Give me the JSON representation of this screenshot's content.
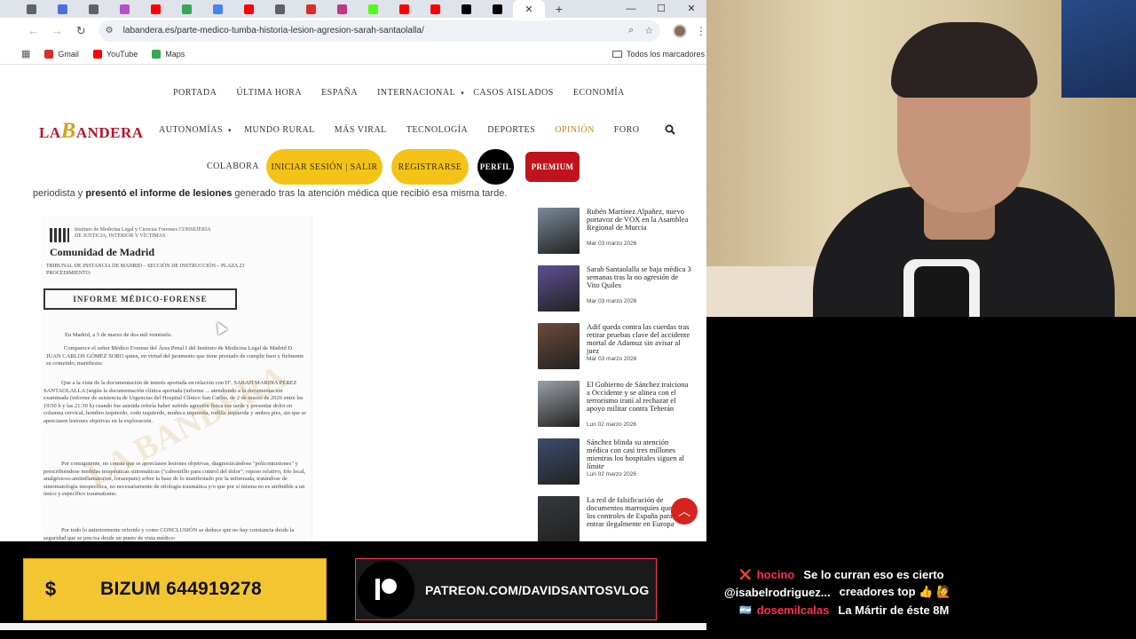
{
  "browser": {
    "url": "labandera.es/parte-medico-tumba-historia-lesion-agresion-sarah-santaolalla/",
    "new_tab_symbol": "+",
    "tabs": [
      {
        "icon": "chevron-down-icon",
        "color": "#5f6368"
      },
      {
        "icon": "b-icon",
        "color": "#4a6fe0"
      },
      {
        "icon": "shield-icon",
        "color": "#5f6368"
      },
      {
        "icon": "p-icon",
        "color": "#b64fc8"
      },
      {
        "icon": "youtube-icon",
        "color": "#ff0000"
      },
      {
        "icon": "puzzle-icon",
        "color": "#3aa655"
      },
      {
        "icon": "google-icon",
        "color": "#4285f4"
      },
      {
        "icon": "youtube-icon",
        "color": "#ff0000"
      },
      {
        "icon": "globe-icon",
        "color": "#5f6368"
      },
      {
        "icon": "gmail-icon",
        "color": "#d93025"
      },
      {
        "icon": "instagram-icon",
        "color": "#c13584"
      },
      {
        "icon": "kick-icon",
        "color": "#53fc18"
      },
      {
        "icon": "youtube-icon",
        "color": "#ff0000"
      },
      {
        "icon": "youtube-icon",
        "color": "#ff0000"
      },
      {
        "icon": "x-icon",
        "color": "#000000"
      },
      {
        "icon": "x-icon",
        "color": "#000000"
      }
    ],
    "bookmarks": [
      {
        "label": "Gmail",
        "color": "#d93025"
      },
      {
        "label": "YouTube",
        "color": "#ff0000"
      },
      {
        "label": "Maps",
        "color": "#34a853"
      }
    ],
    "all_bookmarks": "Todos los marcadores"
  },
  "site": {
    "logo_pre": "LA",
    "logo_big": "B",
    "logo_post": "ANDERA",
    "nav_row1": [
      "PORTADA",
      "ÚLTIMA HORA",
      "ESPAÑA",
      "INTERNACIONAL",
      "CASOS AISLADOS",
      "ECONOMÍA"
    ],
    "nav_row2": [
      "AUTONOMÍAS",
      "MUNDO RURAL",
      "MÁS VIRAL",
      "TECNOLOGÍA",
      "DEPORTES",
      "OPINIÓN",
      "FORO"
    ],
    "collabora": "COLABORA",
    "login": "INICIAR SESIÓN | SALIR",
    "register": "REGISTRARSE",
    "profile": "PERFIL",
    "premium": "PREMIUM",
    "colors": {
      "accent_red": "#b8142a",
      "pill_yellow": "#f3c417",
      "premium_red": "#c0141c",
      "opinion": "#b78a1a"
    }
  },
  "article": {
    "line_pre": "periodista y ",
    "line_bold": "presentó el informe de lesiones",
    "line_post": " generado tras la atención médica que recibió esa misma tarde."
  },
  "document": {
    "header": "Instituto de Medicina Legal y Ciencias Forenses CONSEJERÍA DE JUSTICIA, INTERIOR Y VÍCTIMAS",
    "community": "Comunidad de Madrid",
    "tribunal": "TRIBUNAL DE INSTANCIA DE MADRID – SECCIÓN DE INSTRUCCIÓN – PLAZA 23",
    "procedure": "PROCEDIMIENTO:",
    "box_title": "INFORME MÉDICO-FORENSE",
    "date_line": "En Madrid, a 5 de marzo de dos mil veintiséis.",
    "p1": "Comparece el señor Médico Forense del Área Penal I del Instituto de Medicina Legal de Madrid D. JUAN CARLOS GÓMEZ SORO quien, en virtud del juramento que tiene prestado de cumplir bien y fielmente su cometido, manifiesta:",
    "p2": "Que a la vista de la documentación de interés aportada en relación con Dª. SARAH MARINA PÉREZ SANTAOLALLA (según la documentación clínica aportada (informe ... atendiendo a la documentación examinada (informe de asistencia de Urgencias del Hospital Clínico San Carlos, de 2 de marzo de 2026 entre las 19:50 h y las 21:30 h) cuando fue asistida refería haber sufrido agresión física ese tarde y presentar dolor en columna cervical, hombro izquierdo, codo izquierdo, muñeca izquierda, rodilla izquierda y ambos pies, sin que se apreciasen lesiones objetivas en la exploración.",
    "p3": "Por consiguiente, no consta que se apreciasen lesiones objetivas, diagnosticándose \"policontusiones\" y prescribiéndose medidas terapéuticas sintomáticas (\"cabestrillo para control del dolor\", reposo relativo, frío local, analgésicos-antiinflamatorios, lorazepam) sobre la base de lo manifestado por la informada, tratándose de sintomatología inespecífica, no necesariamente de etiología traumática y/o que por sí misma no es atribuible a un único y específico traumatismo.",
    "p4": "Por todo lo anteriormente referido y como CONCLUSIÓN se deduce que no hay constancia desde la seguridad que se precisa desde un punto de vista médico-",
    "watermark": "LA BANDERA"
  },
  "sidebar": {
    "items": [
      {
        "title": "Rubén Martínez Alpañez, nuevo portavoz de VOX en la Asamblea Regional de Murcia",
        "date": "Mar 03 marzo 2026",
        "thumb": "#7a8a99"
      },
      {
        "title": "Sarah Santaolalla se baja médica 3 semanas tras la no agresión de Vito Quiles",
        "date": "Mar 03 marzo 2026",
        "thumb": "#5d4f93"
      },
      {
        "title": "Adif queda contra las cuerdas tras retirar pruebas clave del accidente mortal de Adamuz sin avisar al juez",
        "date": "Mar 03 marzo 2026",
        "thumb": "#6b4a3a"
      },
      {
        "title": "El Gobierno de Sánchez traiciona a Occidente y se alinea con el terrorismo iraní al rechazar el apoyo militar contra Teherán",
        "date": "Lun 02 marzo 2026",
        "thumb": "#9aa0a6"
      },
      {
        "title": "Sánchez blinda su atención médica con casi tres millones mientras los hospitales siguen al límite",
        "date": "Lun 02 marzo 2026",
        "thumb": "#3b4c6e"
      },
      {
        "title": "La red de falsificación de documentos marroquíes que burla los controles de España para entrar ilegalmente en Europa",
        "date": "",
        "thumb": "#34383d"
      }
    ]
  },
  "overlays": {
    "bizum_symbol": "$",
    "bizum_text": "BIZUM 644919278",
    "patreon_text": "PATREON.COM/DAVIDSANTOSVLOG"
  },
  "chat": [
    {
      "badge": "👁 ❌",
      "user": "hocino",
      "msg": "Se lo curran eso es cierto",
      "user_color": "#ff2d55"
    },
    {
      "badge": "",
      "user": "@isabelrodriguez...",
      "msg": "creadores top 👍 🙋",
      "user_color": "#ffffff"
    },
    {
      "badge": "👁 🇦🇷",
      "user": "dosemilcalas",
      "msg": "La Mártir de éste 8M",
      "user_color": "#ff2d55"
    }
  ]
}
